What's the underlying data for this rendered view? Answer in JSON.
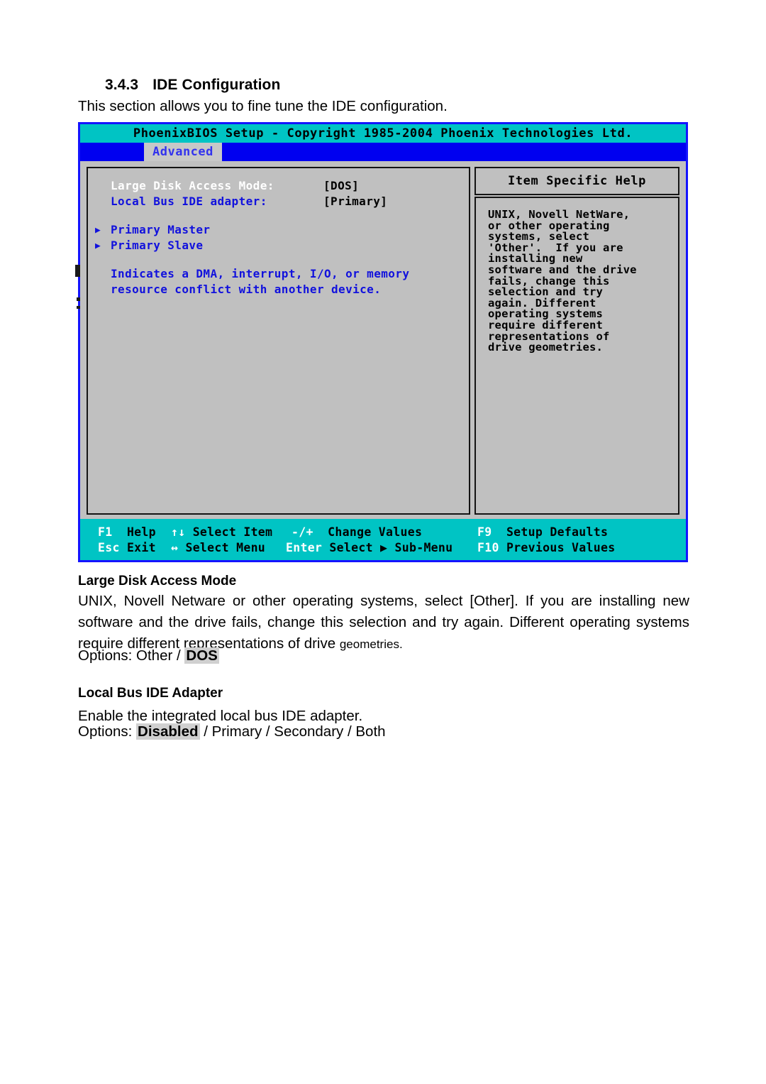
{
  "document": {
    "heading_number": "3.4.3",
    "heading_title": "IDE Configuration",
    "intro": "This section allows you to fine tune the IDE configuration."
  },
  "bios": {
    "title": "PhoenixBIOS Setup - Copyright 1985-2004 Phoenix Technologies Ltd.",
    "active_tab": "Advanced",
    "settings": [
      {
        "label": "Large Disk Access Mode:",
        "value": "[DOS]",
        "selected": true
      },
      {
        "label": "Local Bus IDE adapter:",
        "value": "[Primary]",
        "selected": false
      }
    ],
    "submenus": [
      {
        "marker": "▶",
        "label": "Primary Master"
      },
      {
        "marker": "▶",
        "label": "Primary Slave"
      }
    ],
    "note_lines": [
      "Indicates a DMA, interrupt, I/O, or memory",
      "resource conflict with another device."
    ],
    "help": {
      "title": "Item Specific Help",
      "lines": [
        "UNIX, Novell NetWare,",
        "or other operating",
        "systems, select",
        "'Other'.  If you are",
        "installing new",
        "software and the drive",
        "fails, change this",
        "selection and try",
        "again. Different",
        "operating systems",
        "require different",
        "representations of",
        "drive geometries."
      ]
    },
    "footer": {
      "row1": [
        {
          "key": "F1",
          "desc": "Help"
        },
        {
          "key": "↑↓",
          "desc": "Select Item"
        },
        {
          "key": "-/+",
          "desc": "Change Values"
        },
        {
          "key": "F9",
          "desc": "Setup Defaults"
        }
      ],
      "row2": [
        {
          "key": "Esc",
          "desc": "Exit"
        },
        {
          "key": "↔",
          "desc": "Select Menu"
        },
        {
          "key": "Enter",
          "desc": "Select ▶ Sub-Menu"
        },
        {
          "key": "F10",
          "desc": "Previous Values"
        }
      ]
    },
    "colors": {
      "title_bar": "#00c4c4",
      "menu_bar": "#0000f0",
      "panel": "#c0c0c0",
      "border": "#1414ff",
      "label": "#1111dd",
      "selected_label": "#ffffff"
    }
  },
  "sections": [
    {
      "title": "Large Disk Access Mode",
      "body_pre": "UNIX, Novell Netware or other operating systems, select [Other].  If you are installing new software and the drive fails, change this selection and try again. Different operating systems require different representations of drive ",
      "body_small": "geometries.",
      "options_label": "Options: Other / ",
      "options_highlight": "DOS",
      "options_post": ""
    },
    {
      "title": "Local Bus IDE Adapter",
      "body_pre": "Enable the integrated local bus IDE adapter.",
      "body_small": "",
      "options_label": "Options: ",
      "options_highlight": "Disabled",
      "options_post": " / Primary / Secondary / Both"
    }
  ]
}
